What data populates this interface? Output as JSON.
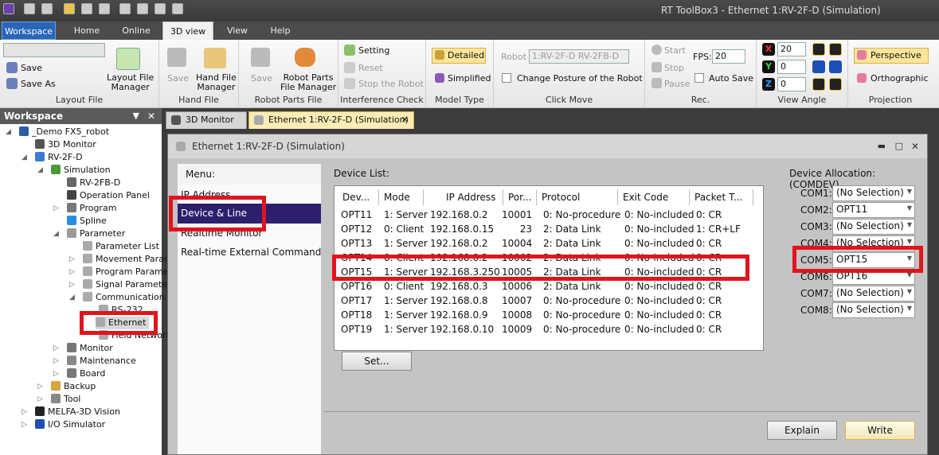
{
  "window": {
    "title": "RT ToolBox3 - Ethernet 1:RV-2F-D (Simulation)"
  },
  "ribbon_tabs": [
    "Workspace",
    "Home",
    "Online",
    "3D view",
    "View",
    "Help"
  ],
  "ribbon": {
    "layout_file": {
      "save": "Save",
      "save_as": "Save As",
      "manager": "Layout File\nManager",
      "label": "Layout File"
    },
    "hand_file": {
      "save": "Save",
      "manager": "Hand File\nManager",
      "label": "Hand File"
    },
    "robot_parts": {
      "save": "Save",
      "manager": "Robot Parts\nFile Manager",
      "label": "Robot Parts File"
    },
    "interference": {
      "setting": "Setting",
      "reset": "Reset",
      "stop": "Stop the Robot",
      "label": "Interference Check"
    },
    "model_type": {
      "detailed": "Detailed",
      "simplified": "Simplified",
      "label": "Model Type"
    },
    "click_move": {
      "robot_label": "Robot",
      "robot_value": "1:RV-2F-D RV-2FB-D",
      "change_posture": "Change Posture of the Robot",
      "label": "Click Move"
    },
    "rec": {
      "start": "Start",
      "stop": "Stop",
      "pause": "Pause",
      "fps_label": "FPS:",
      "fps_value": "20",
      "auto_save": "Auto Save",
      "label": "Rec."
    },
    "view_angle": {
      "x": "20",
      "y": "0",
      "z": "0",
      "label": "View Angle"
    },
    "projection": {
      "perspective": "Perspective",
      "orthographic": "Orthographic",
      "label": "Projection"
    }
  },
  "workspace": {
    "title": "Workspace",
    "tree": [
      "_Demo FX5_robot",
      "3D Monitor",
      "RV-2F-D",
      "Simulation",
      "RV-2FB-D",
      "Operation Panel",
      "Program",
      "Spline",
      "Parameter",
      "Parameter List",
      "Movement Param",
      "Program Parame",
      "Signal Parameter",
      "Communication P",
      "RS-232",
      "Ethernet",
      "Field Network Pa",
      "Monitor",
      "Maintenance",
      "Board",
      "Backup",
      "Tool",
      "MELFA-3D Vision",
      "I/O Simulator"
    ]
  },
  "doc_tabs": [
    "3D Monitor",
    "Ethernet 1:RV-2F-D (Simulation)"
  ],
  "dialog": {
    "title": "Ethernet 1:RV-2F-D (Simulation)",
    "menu_label": "Menu:",
    "menu_items": [
      "IP Address",
      "Device & Line",
      "Realtime Monitor",
      "Real-time External Command"
    ],
    "device_list_label": "Device List:",
    "columns": [
      "Dev...",
      "Mode",
      "IP Address",
      "Por...",
      "Protocol",
      "Exit Code",
      "Packet T..."
    ],
    "rows": [
      [
        "OPT11",
        "1: Server",
        "192.168.0.2",
        "10001",
        "0: No-procedure",
        "0: No-included",
        "0: CR"
      ],
      [
        "OPT12",
        "0: Client",
        "192.168.0.15",
        "23",
        "2: Data Link",
        "0: No-included",
        "1: CR+LF"
      ],
      [
        "OPT13",
        "1: Server",
        "192.168.0.2",
        "10004",
        "2: Data Link",
        "0: No-included",
        "0: CR"
      ],
      [
        "OPT14",
        "0: Client",
        "192.168.0.2",
        "10002",
        "2: Data Link",
        "0: No-included",
        "0: CR"
      ],
      [
        "OPT15",
        "1: Server",
        "192.168.3.250",
        "10005",
        "2: Data Link",
        "0: No-included",
        "0: CR"
      ],
      [
        "OPT16",
        "0: Client",
        "192.168.0.3",
        "10006",
        "2: Data Link",
        "0: No-included",
        "0: CR"
      ],
      [
        "OPT17",
        "1: Server",
        "192.168.0.8",
        "10007",
        "0: No-procedure",
        "0: No-included",
        "0: CR"
      ],
      [
        "OPT18",
        "1: Server",
        "192.168.0.9",
        "10008",
        "0: No-procedure",
        "0: No-included",
        "0: CR"
      ],
      [
        "OPT19",
        "1: Server",
        "192.168.0.10",
        "10009",
        "0: No-procedure",
        "0: No-included",
        "0: CR"
      ]
    ],
    "set_button": "Set...",
    "allocation_label": "Device Allocation: (COMDEV)",
    "allocations": [
      {
        "com": "COM1:",
        "value": "(No Selection)"
      },
      {
        "com": "COM2:",
        "value": "OPT11"
      },
      {
        "com": "COM3:",
        "value": "(No Selection)"
      },
      {
        "com": "COM4:",
        "value": "(No Selection)"
      },
      {
        "com": "COM5:",
        "value": "OPT15"
      },
      {
        "com": "COM6:",
        "value": "OPT16"
      },
      {
        "com": "COM7:",
        "value": "(No Selection)"
      },
      {
        "com": "COM8:",
        "value": "(No Selection)"
      }
    ],
    "explain_button": "Explain",
    "write_button": "Write"
  }
}
